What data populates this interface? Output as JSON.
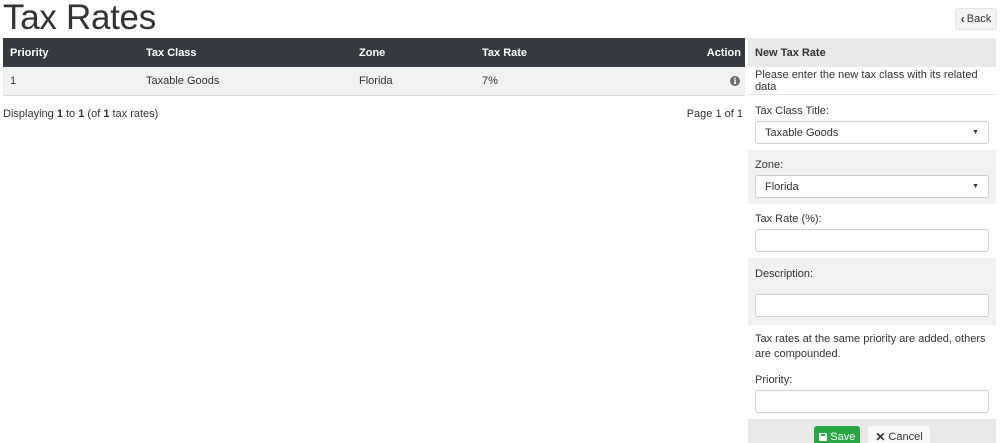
{
  "page": {
    "title": "Tax Rates",
    "back_label": "Back"
  },
  "table": {
    "headers": [
      "Priority",
      "Tax Class",
      "Zone",
      "Tax Rate",
      "Action"
    ],
    "rows": [
      {
        "priority": "1",
        "tax_class": "Taxable Goods",
        "zone": "Florida",
        "tax_rate": "7%",
        "action_icon": "info-icon"
      }
    ]
  },
  "footer": {
    "display_prefix": "Displaying ",
    "display_from": "1",
    "display_to_word": " to ",
    "display_to": "1",
    "display_of_open": " (of ",
    "display_total": "1",
    "display_suffix": " tax rates)",
    "page_info": "Page 1 of 1"
  },
  "form": {
    "heading": "New Tax Rate",
    "intro": "Please enter the new tax class with its related data",
    "tax_class_label": "Tax Class Title:",
    "tax_class_value": "Taxable Goods",
    "zone_label": "Zone:",
    "zone_value": "Florida",
    "tax_rate_label": "Tax Rate (%):",
    "tax_rate_value": "",
    "description_label": "Description:",
    "description_value": "",
    "note": "Tax rates at the same priority are added, others are compounded.",
    "priority_label": "Priority:",
    "priority_value": "",
    "save_label": "Save",
    "cancel_label": "Cancel"
  },
  "colors": {
    "header_bg": "#343a40",
    "save_bg": "#28a745",
    "row_bg": "#f1f1f1"
  }
}
